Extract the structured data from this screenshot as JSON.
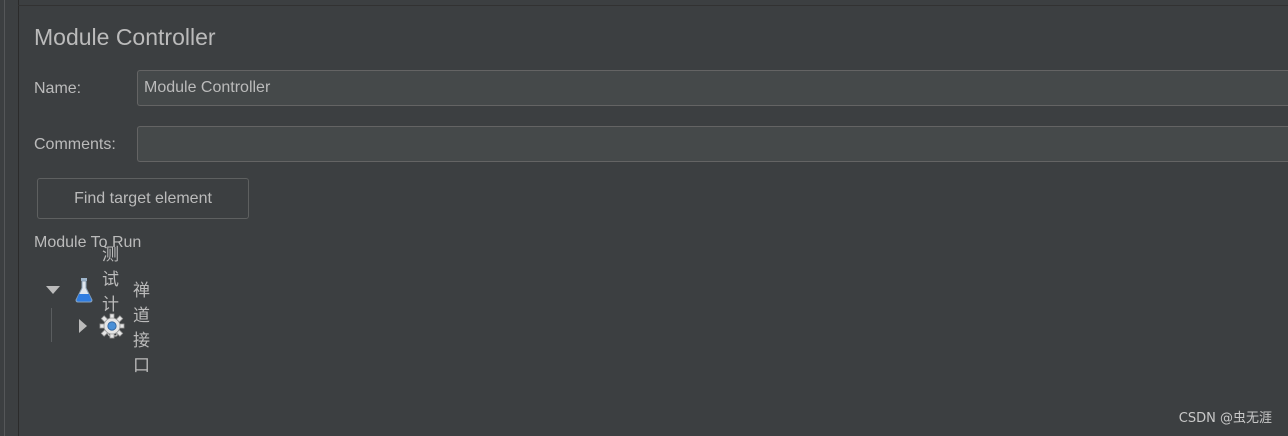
{
  "panel": {
    "title": "Module Controller",
    "name_label": "Name:",
    "name_value": "Module Controller",
    "comments_label": "Comments:",
    "comments_value": "",
    "find_button": "Find target element",
    "module_section_label": "Module To Run"
  },
  "tree": {
    "root": {
      "label": "测试计划",
      "icon": "flask-icon",
      "expanded": true
    },
    "child": {
      "label": "禅道接口",
      "icon": "gear-icon",
      "expanded": false
    }
  },
  "watermark": "CSDN @虫无涯",
  "colors": {
    "background": "#3c3f41",
    "field_bg": "#45494a",
    "text": "#bbbbbb",
    "border": "#646464"
  }
}
